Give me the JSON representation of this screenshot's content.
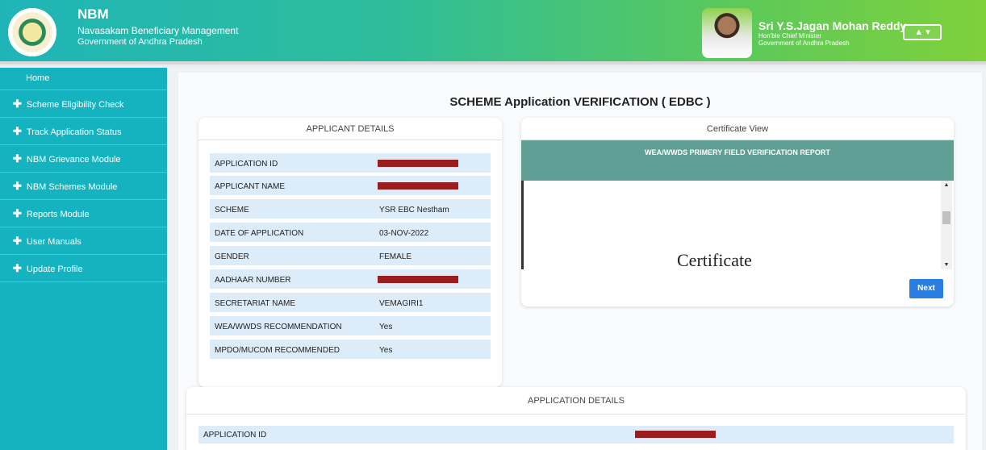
{
  "header": {
    "app_short": "NBM",
    "app_name": "Navasakam Beneficiary Management",
    "government": "Government of Andhra Pradesh",
    "cm_name": "Sri Y.S.Jagan Mohan Reddy",
    "cm_title": "Hon'ble Chief Minister",
    "cm_government": "Government of Andhra Pradesh",
    "user_menu_label": "▲ ▾"
  },
  "sidebar": {
    "home": "Home",
    "items": [
      {
        "label": "Scheme Eligibility Check"
      },
      {
        "label": "Track Application Status"
      },
      {
        "label": "NBM Grievance Module"
      },
      {
        "label": "NBM Schemes Module"
      },
      {
        "label": "Reports Module"
      },
      {
        "label": "User Manuals"
      },
      {
        "label": "Update Profile"
      }
    ]
  },
  "main": {
    "title": "SCHEME Application VERIFICATION ( EDBC )"
  },
  "applicant": {
    "heading": "APPLICANT DETAILS",
    "rows": [
      {
        "label": "APPLICATION ID",
        "value": ""
      },
      {
        "label": "APPLICANT NAME",
        "value": ""
      },
      {
        "label": "SCHEME",
        "value": "YSR EBC Nestham"
      },
      {
        "label": "DATE OF APPLICATION",
        "value": "03-NOV-2022"
      },
      {
        "label": "GENDER",
        "value": "FEMALE"
      },
      {
        "label": "AADHAAR NUMBER",
        "value": ""
      },
      {
        "label": "SECRETARIAT NAME",
        "value": "VEMAGIRI1"
      },
      {
        "label": "WEA/WWDS RECOMMENDATION",
        "value": "Yes"
      },
      {
        "label": "MPDO/MUCOM RECOMMENDED",
        "value": "Yes"
      }
    ]
  },
  "certificate": {
    "heading": "Certificate View",
    "report_title": "WEA/WWDS PRIMERY FIELD VERIFICATION REPORT",
    "doc_text": "Certificate",
    "next_label": "Next"
  },
  "application_details": {
    "heading": "APPLICATION DETAILS",
    "row_label": "APPLICATION ID"
  },
  "colors": {
    "sidebar": "#15b3bf",
    "redaction": "#9b1d1d",
    "row_bg": "#dcedf9",
    "next_button": "#2a7de1"
  }
}
